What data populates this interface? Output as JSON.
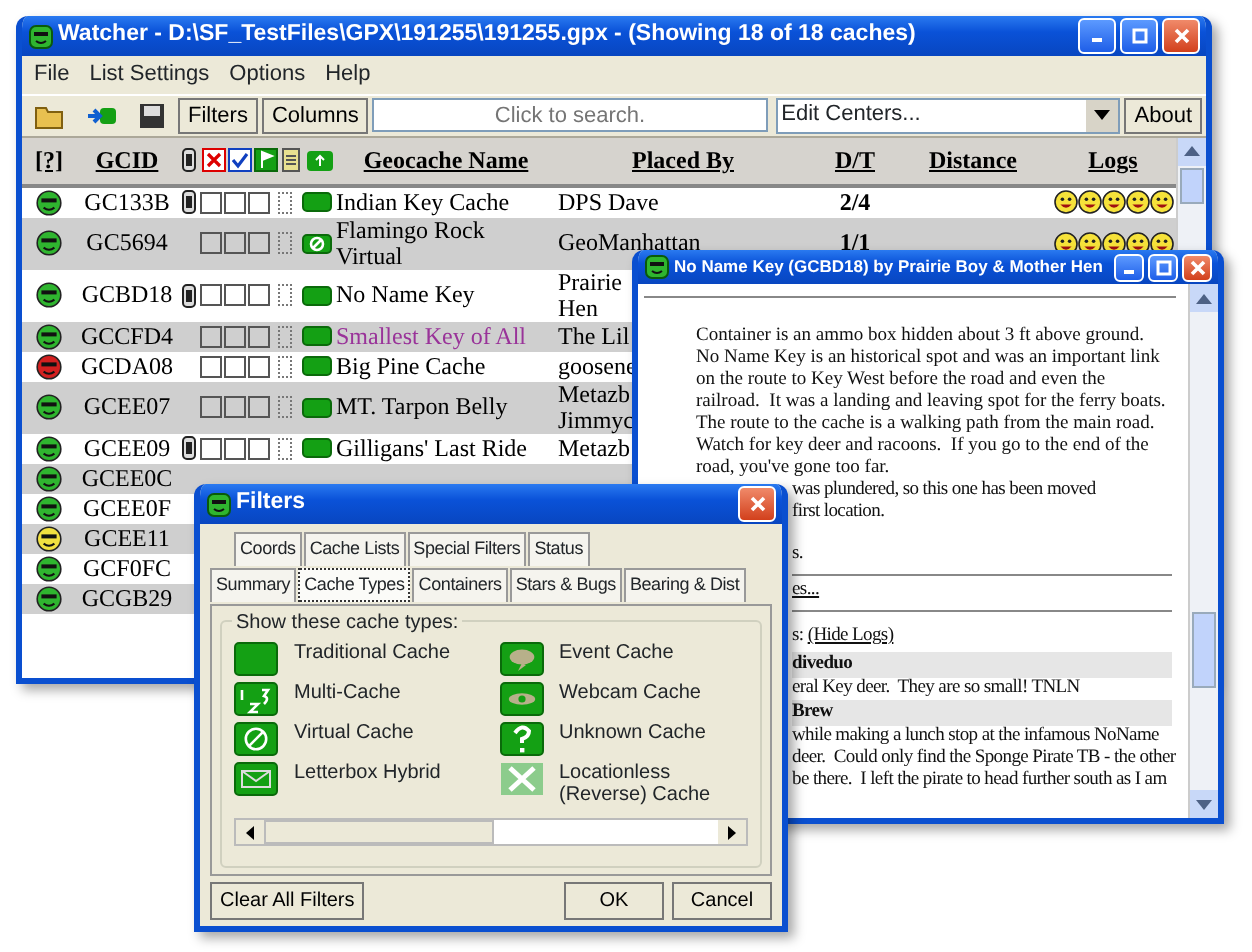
{
  "main_window": {
    "title": "Watcher - D:\\SF_TestFiles\\GPX\\191255\\191255.gpx - (Showing 18 of 18 caches)",
    "menu": [
      "File",
      "List Settings",
      "Options",
      "Help"
    ],
    "toolbar": {
      "buttons": [
        "Filters",
        "Columns"
      ],
      "search_placeholder": "Click to search.",
      "centers": "Edit Centers...",
      "about": "About"
    },
    "columns": [
      "[?]",
      "GCID",
      "Geocache Name",
      "Placed By",
      "D/T",
      "Distance",
      "Logs"
    ],
    "rows": [
      {
        "color": "#2fb52f",
        "gcid": "GC133B",
        "bug": true,
        "checks": [
          false,
          false,
          false
        ],
        "kind": "traditional",
        "name": "Indian Key Cache",
        "highlighted": false,
        "placed_by": "DPS Dave",
        "dt": "2/4",
        "logs": [
          {
            "kind": "smile"
          },
          {
            "kind": "smile"
          },
          {
            "kind": "smile"
          },
          {
            "kind": "smile"
          },
          {
            "kind": "smile"
          }
        ]
      },
      {
        "color": "#2fb52f",
        "gcid": "GC5694",
        "bug": false,
        "checks": [
          false,
          false,
          false
        ],
        "kind": "virtual",
        "name": "Flamingo Rock Virtual",
        "highlighted": false,
        "placed_by": "GeoManhattan",
        "dt": "1/1",
        "logs": [
          {
            "kind": "smile"
          },
          {
            "kind": "smile"
          },
          {
            "kind": "smile"
          },
          {
            "kind": "smile"
          },
          {
            "kind": "smile"
          }
        ]
      },
      {
        "color": "#2fb52f",
        "gcid": "GCBD18",
        "bug": true,
        "checks": [
          false,
          false,
          false
        ],
        "kind": "traditional",
        "name": "No Name Key",
        "highlighted": false,
        "placed_by": "Prairie\nHen"
      },
      {
        "color": "#2fb52f",
        "gcid": "GCCFD4",
        "bug": false,
        "checks": [
          false,
          false,
          false
        ],
        "kind": "traditional",
        "name": "Smallest Key of All",
        "highlighted": true,
        "placed_by": "The Lil"
      },
      {
        "color": "#d42020",
        "gcid": "GCDA08",
        "bug": false,
        "checks": [
          false,
          false,
          false
        ],
        "kind": "traditional",
        "name": "Big Pine Cache",
        "highlighted": false,
        "placed_by": "goosene"
      },
      {
        "color": "#2fb52f",
        "gcid": "GCEE07",
        "bug": false,
        "checks": [
          false,
          false,
          false
        ],
        "kind": "traditional",
        "name": "MT. Tarpon Belly",
        "highlighted": false,
        "placed_by": "Metazb\nJimmyc"
      },
      {
        "color": "#2fb52f",
        "gcid": "GCEE09",
        "bug": true,
        "checks": [
          false,
          false,
          false
        ],
        "kind": "traditional",
        "name": "Gilligans' Last Ride",
        "highlighted": false,
        "placed_by": "Metazb"
      },
      {
        "color": "#2fb52f",
        "gcid": "GCEE0C"
      },
      {
        "color": "#2fb52f",
        "gcid": "GCEE0F"
      },
      {
        "color": "#f0e040",
        "gcid": "GCEE11"
      },
      {
        "color": "#2fb52f",
        "gcid": "GCF0FC"
      },
      {
        "color": "#2fb52f",
        "gcid": "GCGB29"
      }
    ]
  },
  "detail_window": {
    "title": "No Name Key (GCBD18) by Prairie Boy & Mother Hen",
    "description": "Container is an ammo box hidden about 3 ft above ground.   No Name Key is an historical spot and was an important link on the route to Key West before the road and even the railroad.  It was a landing and leaving spot for the ferry boats.  The route to the cache is a walking path from the main road.  Watch for key deer and racoons.  If you go to the end of the road, you've gone too far.",
    "fragments": [
      {
        "kind": "text",
        "text": "was plundered, so this one has been moved"
      },
      {
        "kind": "text",
        "text": "first location."
      },
      {
        "kind": "gap"
      },
      {
        "kind": "text",
        "text": "s."
      },
      {
        "kind": "link",
        "text": "es..."
      },
      {
        "kind": "logs_head",
        "text": "s:",
        "link": "(Hide Logs)"
      },
      {
        "kind": "author",
        "text": "diveduo"
      },
      {
        "kind": "text",
        "text": "eral Key deer.  They are so small! TNLN"
      },
      {
        "kind": "author",
        "text": "Brew"
      },
      {
        "kind": "text",
        "text": "while making a lunch stop at the infamous NoName"
      },
      {
        "kind": "text",
        "text": "deer.  Could only find the Sponge Pirate TB - the other"
      },
      {
        "kind": "text",
        "text": "be there.  I left the pirate to head further south as I am"
      }
    ]
  },
  "filters_dialog": {
    "title": "Filters",
    "tab_rows": [
      [
        {
          "label": "Coords",
          "selected": false
        },
        {
          "label": "Cache Lists",
          "selected": false
        },
        {
          "label": "Special Filters",
          "selected": false
        },
        {
          "label": "Status",
          "selected": false
        }
      ],
      [
        {
          "label": "Summary",
          "selected": false
        },
        {
          "label": "Cache Types",
          "selected": true
        },
        {
          "label": "Containers",
          "selected": false
        },
        {
          "label": "Stars & Bugs",
          "selected": false
        },
        {
          "label": "Bearing & Dist",
          "selected": false
        }
      ]
    ],
    "group_label": "Show these cache types:",
    "cache_types": [
      {
        "kind": "traditional",
        "label": "Traditional Cache"
      },
      {
        "kind": "event",
        "label": "Event Cache"
      },
      {
        "kind": "multi",
        "label": "Multi-Cache"
      },
      {
        "kind": "webcam",
        "label": "Webcam Cache"
      },
      {
        "kind": "virtual",
        "label": "Virtual Cache"
      },
      {
        "kind": "unknown",
        "label": "Unknown Cache"
      },
      {
        "kind": "letterbox",
        "label": "Letterbox Hybrid"
      },
      {
        "kind": "locationless",
        "label": "Locationless (Reverse) Cache"
      }
    ],
    "buttons": [
      "Clear All Filters",
      "OK",
      "Cancel"
    ]
  }
}
